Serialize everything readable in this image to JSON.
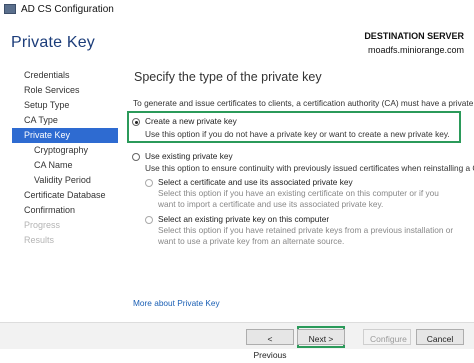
{
  "window": {
    "title": "AD CS Configuration"
  },
  "header": {
    "page_title": "Private Key",
    "destination_label": "DESTINATION SERVER",
    "destination_server": "moadfs.miniorange.com"
  },
  "sidebar": {
    "items": [
      {
        "label": "Credentials",
        "state": "normal"
      },
      {
        "label": "Role Services",
        "state": "normal"
      },
      {
        "label": "Setup Type",
        "state": "normal"
      },
      {
        "label": "CA Type",
        "state": "normal"
      },
      {
        "label": "Private Key",
        "state": "active"
      },
      {
        "label": "Cryptography",
        "state": "sub"
      },
      {
        "label": "CA Name",
        "state": "sub"
      },
      {
        "label": "Validity Period",
        "state": "sub"
      },
      {
        "label": "Certificate Database",
        "state": "normal"
      },
      {
        "label": "Confirmation",
        "state": "normal"
      },
      {
        "label": "Progress",
        "state": "disabled"
      },
      {
        "label": "Results",
        "state": "disabled"
      }
    ]
  },
  "main": {
    "heading": "Specify the type of the private key",
    "intro": "To generate and issue certificates to clients, a certification authority (CA) must have a private key.",
    "option_new": {
      "label": "Create a new private key",
      "description": "Use this option if you do not have a private key or want to create a new private key.",
      "selected": true
    },
    "option_existing": {
      "label": "Use existing private key",
      "description": "Use this option to ensure continuity with previously issued certificates when reinstalling a CA.",
      "selected": false
    },
    "sub_option_cert": {
      "label": "Select a certificate and use its associated private key",
      "description": "Select this option if you have an existing certificate on this computer or if you want to import a certificate and use its associated private key."
    },
    "sub_option_key": {
      "label": "Select an existing private key on this computer",
      "description": "Select this option if you have retained private keys from a previous installation or want to use a private key from an alternate source."
    },
    "more_link": "More about Private Key"
  },
  "footer": {
    "previous": "< Previous",
    "next": "Next >",
    "configure": "Configure",
    "cancel": "Cancel"
  },
  "colors": {
    "accent": "#2e6bd1",
    "highlight": "#2b9a5a",
    "title": "#1c3d7a"
  }
}
